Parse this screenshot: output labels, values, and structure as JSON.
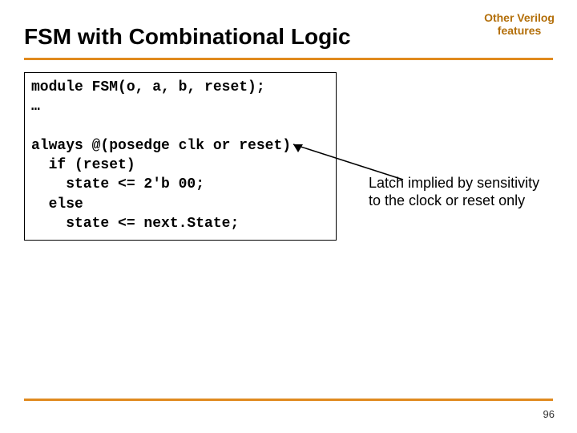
{
  "title": "FSM with Combinational Logic",
  "corner": {
    "line1": "Other Verilog",
    "line2": "features"
  },
  "code": {
    "l1": "module FSM(o, a, b, reset);",
    "l2": "…",
    "l3": "",
    "l4": "always @(posedge clk or reset)",
    "l5": "  if (reset)",
    "l6": "    state <= 2'b 00;",
    "l7": "  else",
    "l8": "    state <= next.State;"
  },
  "annotation": "Latch implied by sensitivity to the clock or reset only",
  "page_number": "96"
}
